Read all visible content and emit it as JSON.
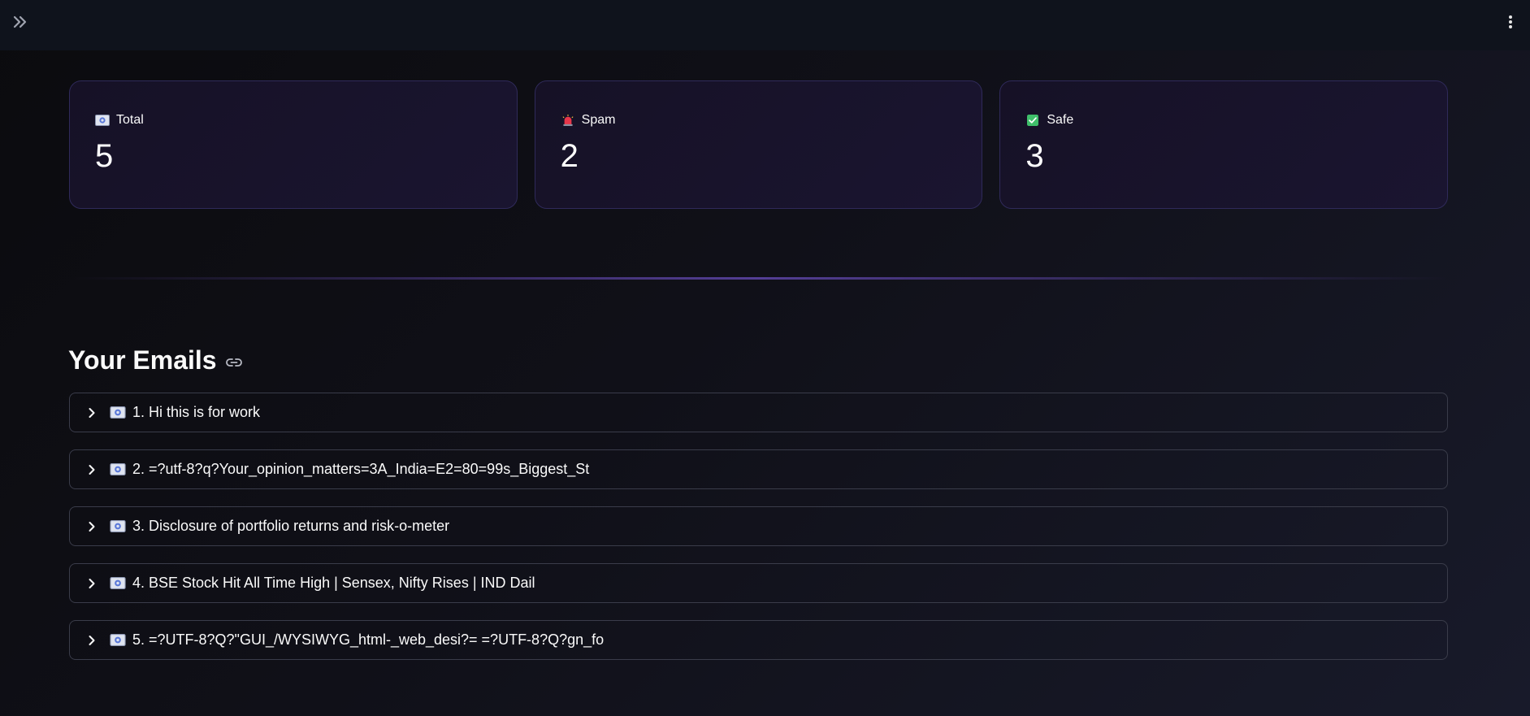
{
  "metrics": [
    {
      "label": "Total",
      "value": "5",
      "icon": "envelope-icon"
    },
    {
      "label": "Spam",
      "value": "2",
      "icon": "siren-icon"
    },
    {
      "label": "Safe",
      "value": "3",
      "icon": "check-mark-icon"
    }
  ],
  "section": {
    "title": "Your Emails"
  },
  "emails": [
    {
      "label": "1. Hi this is for work"
    },
    {
      "label": "2. =?utf-8?q?Your_opinion_matters=3A_India=E2=80=99s_Biggest_St"
    },
    {
      "label": "3. Disclosure of portfolio returns and risk-o-meter"
    },
    {
      "label": "4. BSE Stock Hit All Time High | Sensex, Nifty Rises | IND Dail"
    },
    {
      "label": "5. =?UTF-8?Q?\"GUI_/WYSIWYG_html-_web_desi?= =?UTF-8?Q?gn_fo"
    }
  ],
  "colors": {
    "accent": "#5f46aa",
    "card_border": "#2f2a5a",
    "item_border": "#3a3c4a"
  }
}
